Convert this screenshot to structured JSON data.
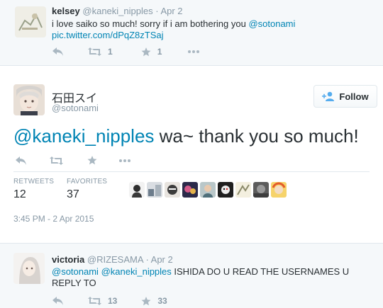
{
  "tweet1": {
    "fullname": "kelsey",
    "username": "@kaneki_nipples",
    "time": "· Apr 2",
    "text_line1": "i love saiko so much! sorry if i am bothering you ",
    "mention": "@sotonami",
    "link": "pic.twitter.com/dPqZ8zTSaj",
    "retweets": "1",
    "favorites": "1"
  },
  "main": {
    "fullname": "石田スイ",
    "username": "@sotonami",
    "follow_label": "Follow",
    "text_mention": "@kaneki_nipples",
    "text_rest": " wa~ thank you so much!",
    "retweets_label": "RETWEETS",
    "retweets_count": "12",
    "favorites_label": "FAVORITES",
    "favorites_count": "37",
    "timestamp": "3:45 PM - 2 Apr 2015"
  },
  "tweet3": {
    "fullname": "victoria",
    "username": "@RIZESAMA",
    "time": "· Apr 2",
    "mention1": "@sotonami",
    "mention2": "@kaneki_nipples",
    "text": " ISHIDA DO U READ THE USERNAMES U REPLY TO",
    "retweets": "13",
    "favorites": "33"
  },
  "icons": [
    "reply-icon",
    "retweet-icon",
    "favorite-icon",
    "more-icon",
    "follow-person-icon"
  ],
  "colors": {
    "link": "#0084b4",
    "muted": "#8899a6",
    "text": "#292f33",
    "highlight_bg": "#f5f8fa",
    "border": "#e1e8ed"
  }
}
